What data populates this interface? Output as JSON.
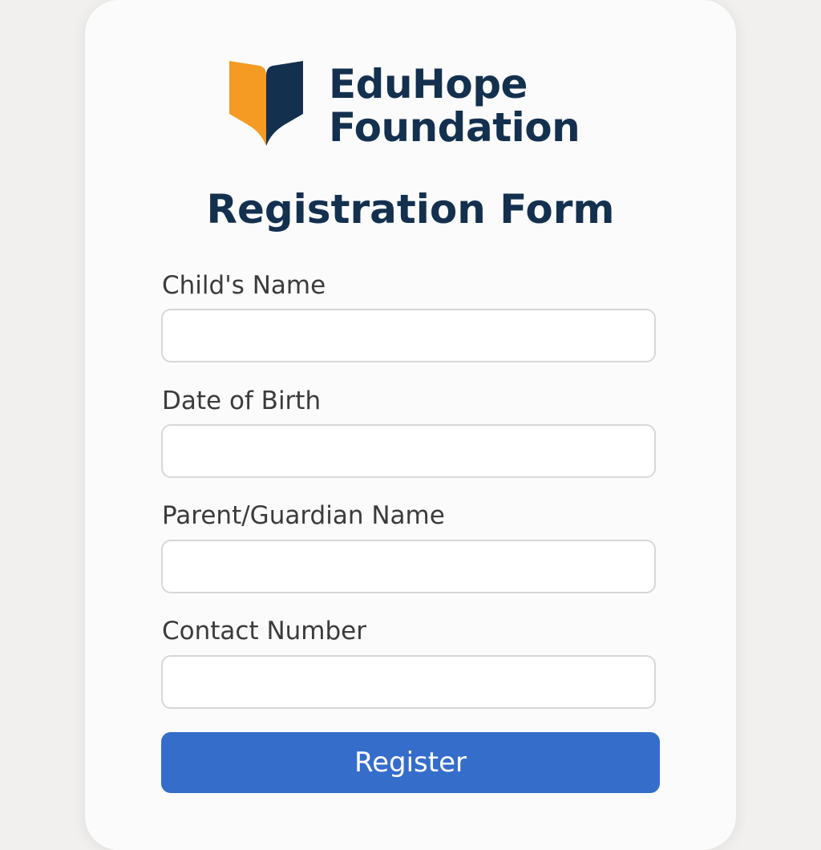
{
  "brand": {
    "line1": "EduHope",
    "line2": "Foundation",
    "logo_icon": "open-book-icon",
    "colors": {
      "orange": "#f59a23",
      "navy": "#14304f"
    }
  },
  "form": {
    "title": "Registration Form",
    "fields": [
      {
        "label": "Child's Name",
        "value": "",
        "placeholder": ""
      },
      {
        "label": "Date of Birth",
        "value": "",
        "placeholder": ""
      },
      {
        "label": "Parent/Guardian Name",
        "value": "",
        "placeholder": ""
      },
      {
        "label": "Contact Number",
        "value": "",
        "placeholder": ""
      }
    ],
    "submit_label": "Register",
    "accent_color": "#356dcb"
  }
}
